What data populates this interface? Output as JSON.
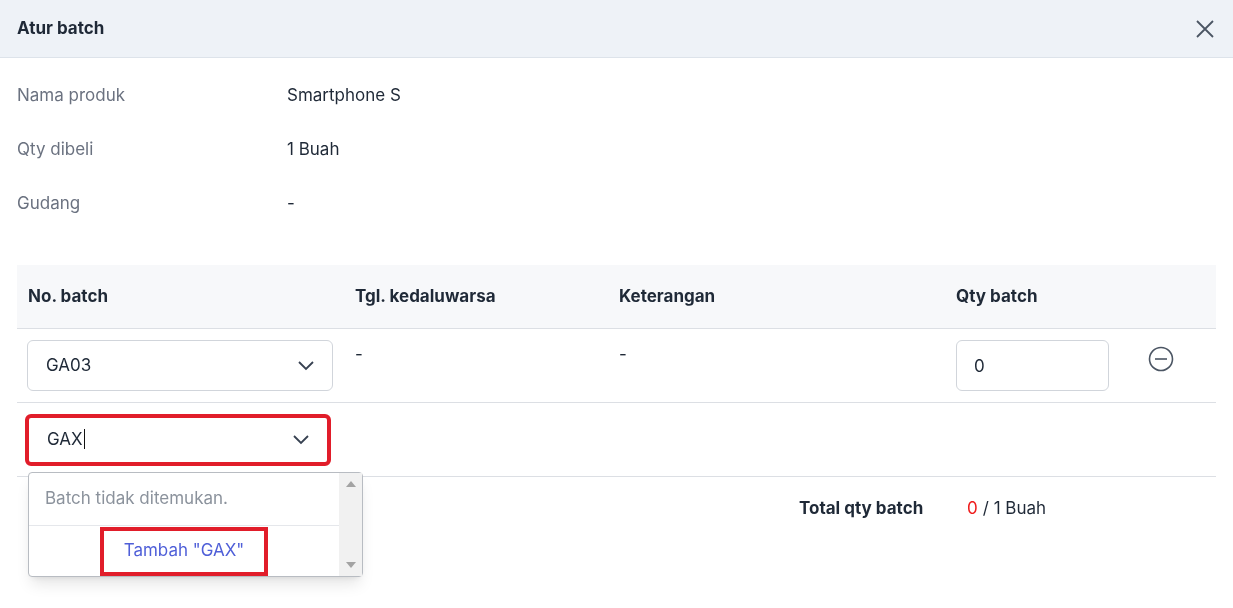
{
  "dialog": {
    "title": "Atur batch"
  },
  "info": [
    {
      "label": "Nama produk",
      "value": "Smartphone S"
    },
    {
      "label": "Qty dibeli",
      "value": "1 Buah"
    },
    {
      "label": "Gudang",
      "value": "-"
    }
  ],
  "table": {
    "columns": [
      "No. batch",
      "Tgl. kedaluwarsa",
      "Keterangan",
      "Qty batch"
    ],
    "rows": [
      {
        "batch": "GA03",
        "expiry": "-",
        "note": "-",
        "qty": "0"
      }
    ],
    "new_row": {
      "value": "GAX",
      "highlighted": true
    }
  },
  "dropdown": {
    "message": "Batch tidak ditemukan.",
    "option": "Tambah \"GAX\"",
    "highlighted": true
  },
  "total": {
    "label": "Total qty batch",
    "count": "0",
    "of": "/ 1 Buah"
  }
}
